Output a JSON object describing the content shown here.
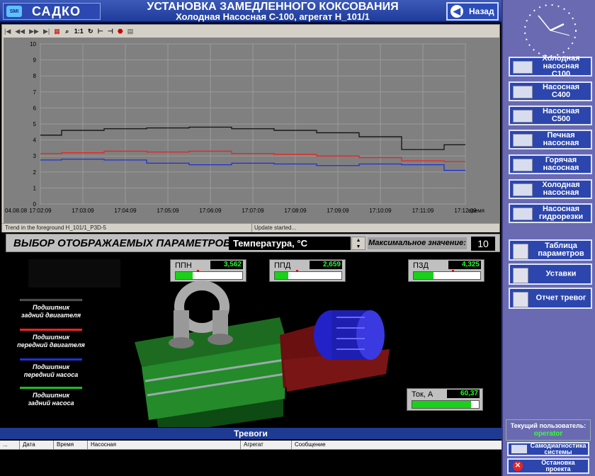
{
  "header": {
    "logo_text": "САДКО",
    "logo_mark": "SMI",
    "title": "УСТАНОВКА ЗАМЕДЛЕННОГО КОКСОВАНИЯ",
    "subtitle": "Холодная Насосная С-100, агрегат Н_101/1",
    "back_label": "Назад"
  },
  "toolbar": {
    "icons": [
      "first-icon",
      "prev-icon",
      "next-icon",
      "last-icon",
      "zoom-area-icon",
      "zoom-icon",
      "reset-zoom-icon",
      "refresh-icon",
      "axis-icon",
      "axis-icon",
      "stop-icon",
      "print-icon"
    ],
    "zoom_label": "1:1"
  },
  "chart_data": {
    "type": "line",
    "ylim": [
      0,
      10
    ],
    "yticks": [
      "0",
      "1",
      "2",
      "3",
      "4",
      "5",
      "6",
      "7",
      "8",
      "9",
      "10"
    ],
    "date_label": "04.08.08",
    "xlabel": "время",
    "categories": [
      "17:02:09",
      "17:03:09",
      "17:04:09",
      "17:05:09",
      "17:06:09",
      "17:07:09",
      "17:08:09",
      "17:09:09",
      "17:10:09",
      "17:11:09",
      "17:12:09"
    ],
    "grid": true,
    "series": [
      {
        "color": "#111111",
        "values": [
          4.3,
          4.6,
          4.7,
          4.75,
          4.8,
          4.7,
          4.6,
          4.45,
          4.2,
          3.4,
          3.7
        ]
      },
      {
        "color": "#ee2222",
        "values": [
          3.15,
          3.2,
          3.3,
          3.25,
          3.3,
          3.15,
          3.1,
          3.0,
          2.9,
          2.7,
          2.65
        ]
      },
      {
        "color": "#1f2fd8",
        "values": [
          2.75,
          2.8,
          2.75,
          2.55,
          2.45,
          2.55,
          2.5,
          2.4,
          2.5,
          2.45,
          2.1
        ]
      }
    ]
  },
  "status": {
    "left": "Trend in the foreground H_101/1_P3D-5",
    "right": "Update started..."
  },
  "selector": {
    "label": "ВЫБОР ОТОБРАЖАЕМЫХ ПАРАМЕТРОВ:",
    "value": "Температура, °С",
    "max_label": "Максимальное значение:",
    "max_value": "10"
  },
  "legend": [
    {
      "color": "#222222",
      "line1": "Подшипник",
      "line2": "задний двигателя"
    },
    {
      "color": "#ee2222",
      "line1": "Подшипник",
      "line2": "передний двигателя"
    },
    {
      "color": "#1f2fd8",
      "line1": "Подшипник",
      "line2": "передний насоса"
    },
    {
      "color": "#22bb22",
      "line1": "Подшипник",
      "line2": "задний насоса"
    }
  ],
  "gauges": [
    {
      "label": "ППН",
      "value": "3,562",
      "fill": 0.25
    },
    {
      "label": "ППД",
      "value": "2,659",
      "fill": 0.2
    },
    {
      "label": "ПЗД",
      "value": "4,325",
      "fill": 0.3
    },
    {
      "label": "Ток, А",
      "value": "60,37",
      "fill": 0.88
    }
  ],
  "alarms": {
    "title": "Тревоги",
    "columns": [
      "...",
      "Дата",
      "Время",
      "Насосная",
      "Агрегат",
      "Сообщение"
    ]
  },
  "nav": [
    {
      "line1": "Холодная",
      "line2": "насосная С100"
    },
    {
      "line1": "Насосная С400",
      "line2": ""
    },
    {
      "line1": "Насосная С500",
      "line2": ""
    },
    {
      "line1": "Печная",
      "line2": "насосная"
    },
    {
      "line1": "Горячая",
      "line2": "насосная"
    },
    {
      "line1": "Холодная",
      "line2": "насосная"
    },
    {
      "line1": "Насосная",
      "line2": "гидрорезки"
    }
  ],
  "tools": [
    {
      "line1": "Таблица",
      "line2": "параметров"
    },
    {
      "line1": "Уставки",
      "line2": ""
    },
    {
      "line1": "Отчет тревог",
      "line2": ""
    }
  ],
  "user": {
    "label": "Текущий пользователь:",
    "name": "operator"
  },
  "system": {
    "diag_line1": "Самодиагностика",
    "diag_line2": "системы",
    "stop_line1": "Остановка",
    "stop_line2": "проекта"
  }
}
